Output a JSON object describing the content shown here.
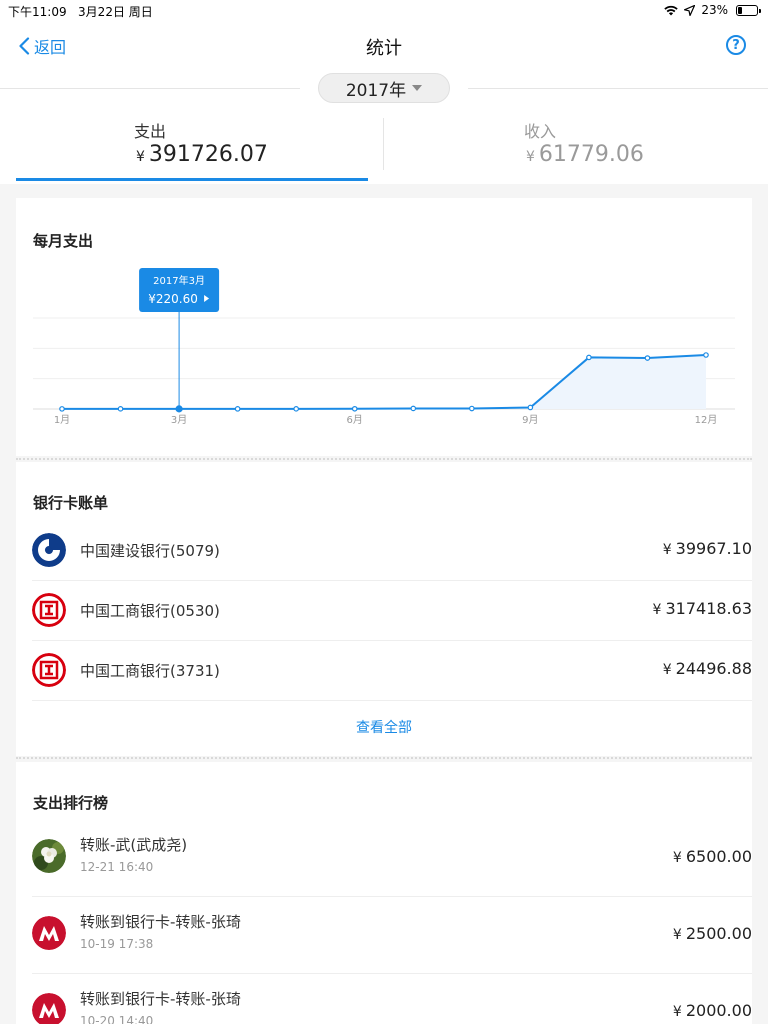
{
  "status_bar": {
    "time": "下午11:09",
    "date": "3月22日 周日",
    "battery": "23%",
    "battery_level": 0.23
  },
  "nav": {
    "back_label": "返回",
    "title": "统计",
    "help_symbol": "?"
  },
  "year_selector": {
    "value": "2017年"
  },
  "totals": {
    "currency": "¥",
    "expense": {
      "label": "支出",
      "amount": "391726.07"
    },
    "income": {
      "label": "收入",
      "amount": "61779.06"
    }
  },
  "monthly": {
    "title": "每月支出"
  },
  "chart_data": {
    "type": "area",
    "title": "每月支出",
    "x": [
      1,
      2,
      3,
      4,
      5,
      6,
      7,
      8,
      9,
      10,
      11,
      12
    ],
    "tick_labels": [
      {
        "x": 1,
        "label": "1月"
      },
      {
        "x": 3,
        "label": "3月"
      },
      {
        "x": 6,
        "label": "6月"
      },
      {
        "x": 9,
        "label": "9月"
      },
      {
        "x": 12,
        "label": "12月"
      }
    ],
    "series": [
      {
        "values": [
          200,
          300,
          220.6,
          250,
          300,
          350,
          900,
          800,
          2500,
          85000,
          84000,
          89000
        ]
      }
    ],
    "ylim": [
      0,
      150000
    ],
    "gridlines": [
      0,
      50000,
      100000,
      150000
    ],
    "line_color": "#1a8ae5",
    "area_color": "#eef5fd",
    "tooltip": {
      "x": 3,
      "title": "2017年3月",
      "value": "220.60",
      "currency": "¥"
    }
  },
  "bank": {
    "title": "银行卡账单",
    "currency": "¥",
    "view_all": "查看全部",
    "items": [
      {
        "name": "中国建设银行(5079)",
        "amount": "39967.10",
        "icon": "ccb-logo-icon"
      },
      {
        "name": "中国工商银行(0530)",
        "amount": "317418.63",
        "icon": "icbc-logo-icon"
      },
      {
        "name": "中国工商银行(3731)",
        "amount": "24496.88",
        "icon": "icbc-logo-icon"
      }
    ]
  },
  "ranking": {
    "title": "支出排行榜",
    "currency": "¥",
    "items": [
      {
        "name": "转账-武(武成尧)",
        "time": "12-21 16:40",
        "amount": "6500.00",
        "icon": "avatar-flower-icon"
      },
      {
        "name": "转账到银行卡-转账-张琦",
        "time": "10-19 17:38",
        "amount": "2500.00",
        "icon": "cmb-logo-icon"
      },
      {
        "name": "转账到银行卡-转账-张琦",
        "time": "10-20 14:40",
        "amount": "2000.00",
        "icon": "cmb-logo-icon"
      }
    ]
  },
  "colors": {
    "accent": "#1a8ae5",
    "icbc_red": "#d7000f",
    "ccb_blue": "#0f3c8a",
    "cmb_red": "#c8102e"
  }
}
